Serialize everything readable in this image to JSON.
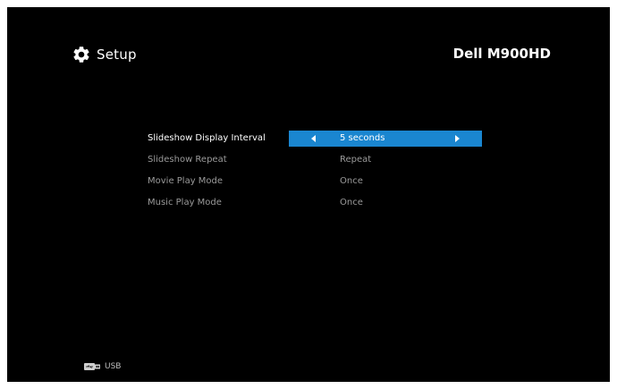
{
  "header": {
    "title": "Setup",
    "brand": "Dell M900HD",
    "icon": "gear-icon"
  },
  "settings": [
    {
      "label": "Slideshow Display Interval",
      "value": "5 seconds",
      "selected": true
    },
    {
      "label": "Slideshow Repeat",
      "value": "Repeat",
      "selected": false
    },
    {
      "label": "Movie Play Mode",
      "value": "Once",
      "selected": false
    },
    {
      "label": "Music Play Mode",
      "value": "Once",
      "selected": false
    }
  ],
  "footer": {
    "source_label": "USB",
    "icon": "usb-icon"
  },
  "colors": {
    "background": "#000000",
    "selection": "#1a86d0",
    "text_active": "#ffffff",
    "text_inactive": "#9a9a9a"
  }
}
